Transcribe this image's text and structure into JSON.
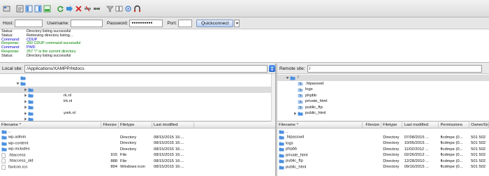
{
  "toolbar": {
    "icons": [
      "site-manager-icon",
      "toggle-log-icon",
      "toggle-local-tree-icon",
      "toggle-remote-tree-icon",
      "toggle-queue-icon",
      "refresh-icon",
      "process-queue-icon",
      "cancel-icon",
      "disconnect-icon",
      "reconnect-icon",
      "directory-filters-icon",
      "directory-compare-icon",
      "sync-browsing-icon",
      "search-files-icon"
    ]
  },
  "quickconnect": {
    "host_label": "Host:",
    "host_value": "",
    "username_label": "Username:",
    "username_value": "",
    "password_label": "Password:",
    "password_value": "●●●●●●●●●●",
    "port_label": "Port:",
    "port_value": "",
    "button_label": "Quickconnect"
  },
  "log": [
    {
      "kind": "Status:",
      "msg": "Directory listing successful"
    },
    {
      "kind": "Status:",
      "msg": "Retrieving directory listing..."
    },
    {
      "kind": "Command:",
      "msg": "CDUP"
    },
    {
      "kind": "Response:",
      "msg": "250 CDUP command successful"
    },
    {
      "kind": "Command:",
      "msg": "PWD"
    },
    {
      "kind": "Response:",
      "msg": "257 \"/\" is the current directory"
    },
    {
      "kind": "Status:",
      "msg": "Directory listing successful"
    }
  ],
  "local": {
    "site_label": "Local site:",
    "path": "/Applications/XAMPP/htdocs",
    "tree": [
      {
        "label": "",
        "indent": 2,
        "arrow": "none"
      },
      {
        "label": "",
        "indent": 2,
        "arrow": "down"
      },
      {
        "label": "",
        "indent": 3,
        "arrow": "right",
        "selected": true
      },
      {
        "label": "rk.nl",
        "indent": 3,
        "arrow": "right"
      },
      {
        "label": "irk.nl",
        "indent": 3,
        "arrow": "right"
      },
      {
        "label": "",
        "indent": 3,
        "arrow": "right"
      },
      {
        "label": "york.nl",
        "indent": 3,
        "arrow": "right"
      },
      {
        "label": "",
        "indent": 3,
        "arrow": "right"
      },
      {
        "label": "",
        "indent": 3,
        "arrow": "right"
      }
    ],
    "columns": [
      "Filename ^",
      "Filesize",
      "Filetype",
      "Last modified"
    ],
    "files": [
      {
        "name": "..",
        "size": "",
        "type": "",
        "modified": "",
        "icon": "parent-folder-icon"
      },
      {
        "name": "wp-admin",
        "size": "",
        "type": "Directory",
        "modified": "08/15/2015 16:...",
        "icon": "folder-icon"
      },
      {
        "name": "wp-content",
        "size": "",
        "type": "Directory",
        "modified": "08/15/2015 16:...",
        "icon": "folder-icon"
      },
      {
        "name": "wp-includes",
        "size": "",
        "type": "Directory",
        "modified": "08/15/2015 16:...",
        "icon": "folder-icon"
      },
      {
        "name": ".htaccess",
        "size": "915",
        "type": "File",
        "modified": "08/15/2015 16:...",
        "icon": "file-icon"
      },
      {
        "name": ".htaccess_old",
        "size": "888",
        "type": "File",
        "modified": "08/15/2015 16:...",
        "icon": "file-icon"
      },
      {
        "name": "favicon.ico",
        "size": "894",
        "type": "Windows icon",
        "modified": "08/15/2015 16:...",
        "icon": "file-icon"
      }
    ]
  },
  "remote": {
    "site_label": "Remote site:",
    "path": "/",
    "tree": [
      {
        "label": "/",
        "indent": 1,
        "arrow": "down",
        "selected": true,
        "kind": "root"
      },
      {
        "label": ".htpasswd",
        "indent": 2,
        "arrow": "none",
        "kind": "unknown"
      },
      {
        "label": "logs",
        "indent": 2,
        "arrow": "none",
        "kind": "unknown"
      },
      {
        "label": "phpbb",
        "indent": 2,
        "arrow": "none",
        "kind": "unknown"
      },
      {
        "label": "private_html",
        "indent": 2,
        "arrow": "none",
        "kind": "unknown"
      },
      {
        "label": "public_ftp",
        "indent": 2,
        "arrow": "none",
        "kind": "unknown"
      },
      {
        "label": "public_html",
        "indent": 2,
        "arrow": "right",
        "kind": "folder"
      }
    ],
    "columns": [
      "Filename ^",
      "Filesize",
      "Filetype",
      "Last modified",
      "Permissions",
      "Owner/Gr"
    ],
    "files": [
      {
        "name": "..",
        "size": "",
        "type": "",
        "modified": "",
        "perms": "",
        "owner": "",
        "icon": "parent-folder-icon"
      },
      {
        "name": ".htpasswd",
        "size": "",
        "type": "Directory",
        "modified": "07/08/2015 ...",
        "perms": "flcdmpe (0...",
        "owner": "501 502",
        "icon": "folder-icon"
      },
      {
        "name": "logs",
        "size": "",
        "type": "Directory",
        "modified": "10/05/2015 ...",
        "perms": "flcdmpe (0...",
        "owner": "501 502",
        "icon": "folder-icon"
      },
      {
        "name": "phpbb",
        "size": "",
        "type": "Directory",
        "modified": "11/02/2012 ...",
        "perms": "flcdmpe (0...",
        "owner": "501 502",
        "icon": "folder-icon"
      },
      {
        "name": "private_html",
        "size": "",
        "type": "Directory",
        "modified": "02/26/2012 ...",
        "perms": "flcdmpe (0...",
        "owner": "501 502",
        "icon": "folder-icon"
      },
      {
        "name": "public_ftp",
        "size": "",
        "type": "Directory",
        "modified": "12/28/2010 ...",
        "perms": "flcdmpe (0...",
        "owner": "501 502",
        "icon": "folder-icon"
      },
      {
        "name": "public_html",
        "size": "",
        "type": "Directory",
        "modified": "09/16/2015 ...",
        "perms": "flcdmpe (0...",
        "owner": "501 502",
        "icon": "folder-icon"
      }
    ]
  },
  "colors": {
    "selection": "#dcdcdc",
    "folder": "#4a8fe0",
    "command": "#0000cc",
    "response": "#008000",
    "quickconnect_accent": "#7d95bd"
  }
}
